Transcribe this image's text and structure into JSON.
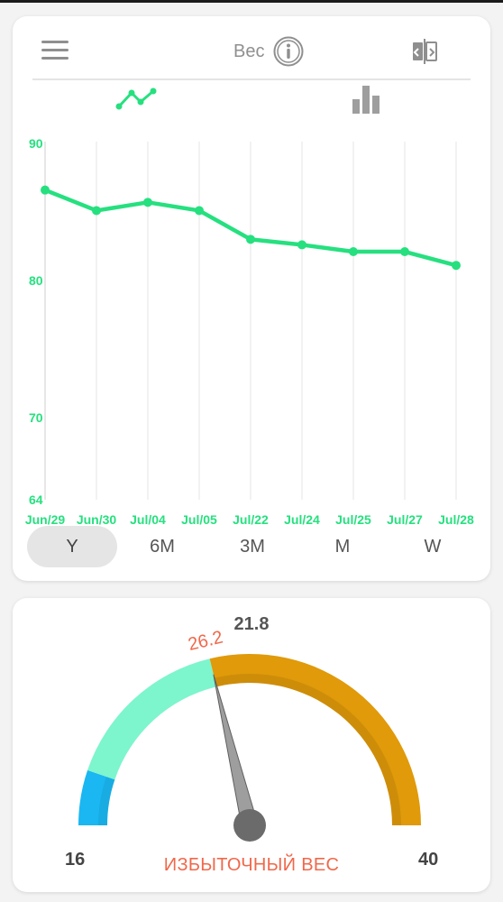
{
  "header": {
    "title": "Вес",
    "menu_icon": "hamburger-menu-icon",
    "info_icon": "info-icon",
    "swap_icon": "swap-icon"
  },
  "chart_type_toggle": {
    "options": [
      "line",
      "bar"
    ],
    "selected": "line",
    "active_color": "#26e07f",
    "inactive_color": "#9e9e9e"
  },
  "chart_data": {
    "type": "line",
    "title": "",
    "xlabel": "",
    "ylabel": "",
    "x": [
      "Jun/29",
      "Jun/30",
      "Jul/04",
      "Jul/05",
      "Jul/22",
      "Jul/24",
      "Jul/25",
      "Jul/27",
      "Jul/28"
    ],
    "series": [
      {
        "values": [
          86.6,
          85.1,
          85.7,
          85.1,
          83.0,
          82.6,
          82.1,
          82.1,
          81.1
        ]
      }
    ],
    "ylim": [
      64,
      90
    ],
    "yticks": [
      64,
      70,
      80,
      90
    ],
    "grid": "vertical",
    "line_color": "#26e07f",
    "label_color": "#26e07f"
  },
  "periods": {
    "items": [
      "Y",
      "6M",
      "3M",
      "M",
      "W"
    ],
    "selected": "Y"
  },
  "bmi": {
    "value": "21.8",
    "marker_value": "26.2",
    "min_label": "16",
    "max_label": "40",
    "min": 16,
    "max": 40,
    "needle_value": 26.2,
    "zones": [
      {
        "from": 16,
        "to": 18.5,
        "color": "#1ab7f2"
      },
      {
        "from": 18.5,
        "to": 26.2,
        "color": "#7df5cd"
      },
      {
        "from": 26.2,
        "to": 40,
        "color": "#e09a0a"
      }
    ],
    "status": "ИЗБЫТОЧНЫЙ ВЕС",
    "status_color": "#f0684a"
  }
}
